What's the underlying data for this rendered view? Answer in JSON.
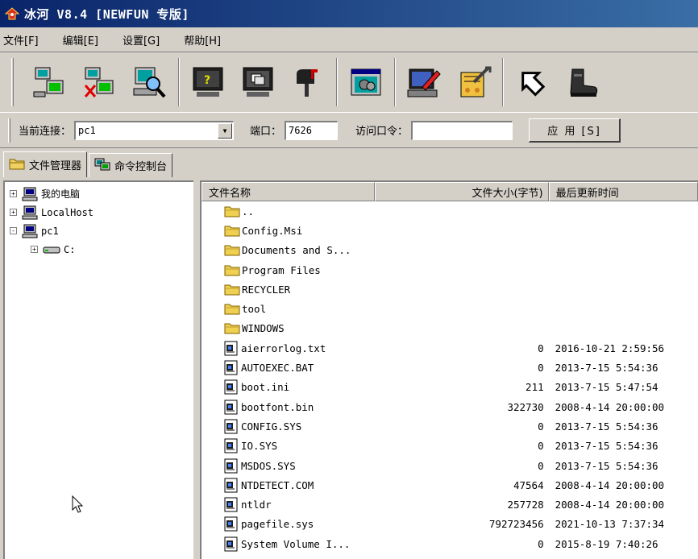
{
  "window": {
    "title": "冰河 V8.4 [NEWFUN 专版]"
  },
  "menu": [
    "文件[F]",
    "编辑[E]",
    "设置[G]",
    "帮助[H]"
  ],
  "toolbar": {
    "icons": [
      "add-host-icon",
      "remove-host-icon",
      "search-hosts-icon",
      "screen-capture-icon",
      "screen-control-icon",
      "mailbox-icon",
      "config-server-icon",
      "edit-server-icon",
      "tools-config-icon",
      "back-icon",
      "exit-boot-icon"
    ]
  },
  "connection": {
    "current_label": "当前连接：",
    "current_value": "pc1",
    "port_label": "端口：",
    "port_value": "7626",
    "password_label": "访问口令：",
    "password_value": "",
    "apply_label": "应 用 [S]"
  },
  "tabs": [
    {
      "label": "文件管理器",
      "active": true
    },
    {
      "label": "命令控制台",
      "active": false
    }
  ],
  "tree": [
    {
      "label": "我的电脑",
      "expander": "+",
      "indent": 0,
      "icon": "computer-icon"
    },
    {
      "label": "LocalHost",
      "expander": "+",
      "indent": 0,
      "icon": "computer-icon"
    },
    {
      "label": "pc1",
      "expander": "-",
      "indent": 0,
      "icon": "computer-icon"
    },
    {
      "label": "C:",
      "expander": "+",
      "indent": 1,
      "icon": "drive-icon"
    }
  ],
  "filelist": {
    "headers": {
      "name": "文件名称",
      "size": "文件大小(字节)",
      "date": "最后更新时间"
    },
    "rows": [
      {
        "type": "folder",
        "name": "..",
        "size": "",
        "date": ""
      },
      {
        "type": "folder",
        "name": "Config.Msi",
        "size": "",
        "date": ""
      },
      {
        "type": "folder",
        "name": "Documents and S...",
        "size": "",
        "date": ""
      },
      {
        "type": "folder",
        "name": "Program Files",
        "size": "",
        "date": ""
      },
      {
        "type": "folder",
        "name": "RECYCLER",
        "size": "",
        "date": ""
      },
      {
        "type": "folder",
        "name": "tool",
        "size": "",
        "date": ""
      },
      {
        "type": "folder",
        "name": "WINDOWS",
        "size": "",
        "date": ""
      },
      {
        "type": "file",
        "name": "aierrorlog.txt",
        "size": "0",
        "date": "2016-10-21 2:59:56"
      },
      {
        "type": "file",
        "name": "AUTOEXEC.BAT",
        "size": "0",
        "date": "2013-7-15 5:54:36"
      },
      {
        "type": "file",
        "name": "boot.ini",
        "size": "211",
        "date": "2013-7-15 5:47:54"
      },
      {
        "type": "file",
        "name": "bootfont.bin",
        "size": "322730",
        "date": "2008-4-14 20:00:00"
      },
      {
        "type": "file",
        "name": "CONFIG.SYS",
        "size": "0",
        "date": "2013-7-15 5:54:36"
      },
      {
        "type": "file",
        "name": "IO.SYS",
        "size": "0",
        "date": "2013-7-15 5:54:36"
      },
      {
        "type": "file",
        "name": "MSDOS.SYS",
        "size": "0",
        "date": "2013-7-15 5:54:36"
      },
      {
        "type": "file",
        "name": "NTDETECT.COM",
        "size": "47564",
        "date": "2008-4-14 20:00:00"
      },
      {
        "type": "file",
        "name": "ntldr",
        "size": "257728",
        "date": "2008-4-14 20:00:00"
      },
      {
        "type": "file",
        "name": "pagefile.sys",
        "size": "792723456",
        "date": "2021-10-13 7:37:34"
      },
      {
        "type": "file",
        "name": "System Volume I...",
        "size": "0",
        "date": "2015-8-19 7:40:26"
      }
    ]
  }
}
